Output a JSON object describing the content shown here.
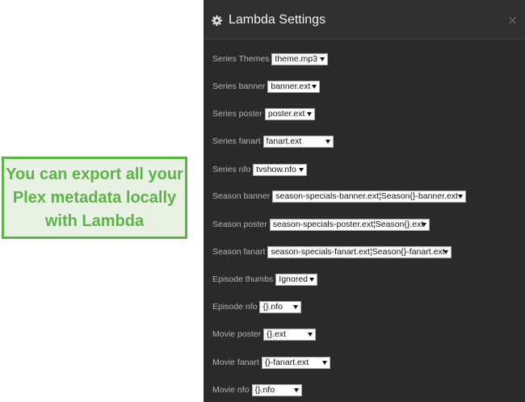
{
  "callout": {
    "text": "You can export all your Plex metadata locally with Lambda",
    "accent_color": "#5cb346"
  },
  "modal": {
    "title": "Lambda Settings",
    "title_icon": "gear-icon",
    "close_label": "×"
  },
  "settings": [
    {
      "label": "Series Themes",
      "value": "theme.mp3"
    },
    {
      "label": "Series banner",
      "value": "banner.ext"
    },
    {
      "label": "Series poster",
      "value": "poster.ext"
    },
    {
      "label": "Series fanart",
      "value": "fanart.ext"
    },
    {
      "label": "Series nfo",
      "value": "tvshow.nfo"
    },
    {
      "label": "Season banner",
      "value": "season-specials-banner.ext¦Season{}-banner.ext"
    },
    {
      "label": "Season poster",
      "value": "season-specials-poster.ext¦Season{}.ext"
    },
    {
      "label": "Season fanart",
      "value": "season-specials-fanart.ext¦Season{}-fanart.ext"
    },
    {
      "label": "Episode thumbs",
      "value": "Ignored"
    },
    {
      "label": "Episode nfo",
      "value": "{}.nfo"
    },
    {
      "label": "Movie poster",
      "value": "{}.ext"
    },
    {
      "label": "Movie fanart",
      "value": "{}-fanart.ext"
    },
    {
      "label": "Movie nfo",
      "value": "{}.nfo"
    }
  ]
}
